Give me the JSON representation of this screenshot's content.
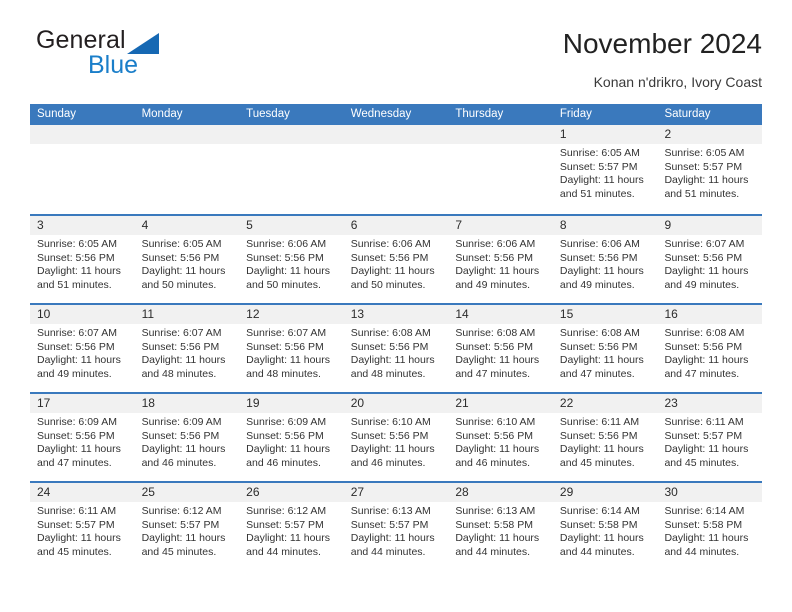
{
  "brand": {
    "word_one": "General",
    "word_two": "Blue",
    "triangle_color": "#1668b3",
    "blue_color": "#1a7ec9"
  },
  "header": {
    "title": "November 2024",
    "location": "Konan n'drikro, Ivory Coast"
  },
  "theme": {
    "header_blue": "#3a79bd",
    "daynum_band": "#f1f1f1"
  },
  "weekdays": [
    "Sunday",
    "Monday",
    "Tuesday",
    "Wednesday",
    "Thursday",
    "Friday",
    "Saturday"
  ],
  "weeks": [
    [
      {
        "day": "",
        "empty": true
      },
      {
        "day": "",
        "empty": true
      },
      {
        "day": "",
        "empty": true
      },
      {
        "day": "",
        "empty": true
      },
      {
        "day": "",
        "empty": true
      },
      {
        "day": "1",
        "sunrise": "Sunrise: 6:05 AM",
        "sunset": "Sunset: 5:57 PM",
        "daylight1": "Daylight: 11 hours",
        "daylight2": "and 51 minutes."
      },
      {
        "day": "2",
        "sunrise": "Sunrise: 6:05 AM",
        "sunset": "Sunset: 5:57 PM",
        "daylight1": "Daylight: 11 hours",
        "daylight2": "and 51 minutes."
      }
    ],
    [
      {
        "day": "3",
        "sunrise": "Sunrise: 6:05 AM",
        "sunset": "Sunset: 5:56 PM",
        "daylight1": "Daylight: 11 hours",
        "daylight2": "and 51 minutes."
      },
      {
        "day": "4",
        "sunrise": "Sunrise: 6:05 AM",
        "sunset": "Sunset: 5:56 PM",
        "daylight1": "Daylight: 11 hours",
        "daylight2": "and 50 minutes."
      },
      {
        "day": "5",
        "sunrise": "Sunrise: 6:06 AM",
        "sunset": "Sunset: 5:56 PM",
        "daylight1": "Daylight: 11 hours",
        "daylight2": "and 50 minutes."
      },
      {
        "day": "6",
        "sunrise": "Sunrise: 6:06 AM",
        "sunset": "Sunset: 5:56 PM",
        "daylight1": "Daylight: 11 hours",
        "daylight2": "and 50 minutes."
      },
      {
        "day": "7",
        "sunrise": "Sunrise: 6:06 AM",
        "sunset": "Sunset: 5:56 PM",
        "daylight1": "Daylight: 11 hours",
        "daylight2": "and 49 minutes."
      },
      {
        "day": "8",
        "sunrise": "Sunrise: 6:06 AM",
        "sunset": "Sunset: 5:56 PM",
        "daylight1": "Daylight: 11 hours",
        "daylight2": "and 49 minutes."
      },
      {
        "day": "9",
        "sunrise": "Sunrise: 6:07 AM",
        "sunset": "Sunset: 5:56 PM",
        "daylight1": "Daylight: 11 hours",
        "daylight2": "and 49 minutes."
      }
    ],
    [
      {
        "day": "10",
        "sunrise": "Sunrise: 6:07 AM",
        "sunset": "Sunset: 5:56 PM",
        "daylight1": "Daylight: 11 hours",
        "daylight2": "and 49 minutes."
      },
      {
        "day": "11",
        "sunrise": "Sunrise: 6:07 AM",
        "sunset": "Sunset: 5:56 PM",
        "daylight1": "Daylight: 11 hours",
        "daylight2": "and 48 minutes."
      },
      {
        "day": "12",
        "sunrise": "Sunrise: 6:07 AM",
        "sunset": "Sunset: 5:56 PM",
        "daylight1": "Daylight: 11 hours",
        "daylight2": "and 48 minutes."
      },
      {
        "day": "13",
        "sunrise": "Sunrise: 6:08 AM",
        "sunset": "Sunset: 5:56 PM",
        "daylight1": "Daylight: 11 hours",
        "daylight2": "and 48 minutes."
      },
      {
        "day": "14",
        "sunrise": "Sunrise: 6:08 AM",
        "sunset": "Sunset: 5:56 PM",
        "daylight1": "Daylight: 11 hours",
        "daylight2": "and 47 minutes."
      },
      {
        "day": "15",
        "sunrise": "Sunrise: 6:08 AM",
        "sunset": "Sunset: 5:56 PM",
        "daylight1": "Daylight: 11 hours",
        "daylight2": "and 47 minutes."
      },
      {
        "day": "16",
        "sunrise": "Sunrise: 6:08 AM",
        "sunset": "Sunset: 5:56 PM",
        "daylight1": "Daylight: 11 hours",
        "daylight2": "and 47 minutes."
      }
    ],
    [
      {
        "day": "17",
        "sunrise": "Sunrise: 6:09 AM",
        "sunset": "Sunset: 5:56 PM",
        "daylight1": "Daylight: 11 hours",
        "daylight2": "and 47 minutes."
      },
      {
        "day": "18",
        "sunrise": "Sunrise: 6:09 AM",
        "sunset": "Sunset: 5:56 PM",
        "daylight1": "Daylight: 11 hours",
        "daylight2": "and 46 minutes."
      },
      {
        "day": "19",
        "sunrise": "Sunrise: 6:09 AM",
        "sunset": "Sunset: 5:56 PM",
        "daylight1": "Daylight: 11 hours",
        "daylight2": "and 46 minutes."
      },
      {
        "day": "20",
        "sunrise": "Sunrise: 6:10 AM",
        "sunset": "Sunset: 5:56 PM",
        "daylight1": "Daylight: 11 hours",
        "daylight2": "and 46 minutes."
      },
      {
        "day": "21",
        "sunrise": "Sunrise: 6:10 AM",
        "sunset": "Sunset: 5:56 PM",
        "daylight1": "Daylight: 11 hours",
        "daylight2": "and 46 minutes."
      },
      {
        "day": "22",
        "sunrise": "Sunrise: 6:11 AM",
        "sunset": "Sunset: 5:56 PM",
        "daylight1": "Daylight: 11 hours",
        "daylight2": "and 45 minutes."
      },
      {
        "day": "23",
        "sunrise": "Sunrise: 6:11 AM",
        "sunset": "Sunset: 5:57 PM",
        "daylight1": "Daylight: 11 hours",
        "daylight2": "and 45 minutes."
      }
    ],
    [
      {
        "day": "24",
        "sunrise": "Sunrise: 6:11 AM",
        "sunset": "Sunset: 5:57 PM",
        "daylight1": "Daylight: 11 hours",
        "daylight2": "and 45 minutes."
      },
      {
        "day": "25",
        "sunrise": "Sunrise: 6:12 AM",
        "sunset": "Sunset: 5:57 PM",
        "daylight1": "Daylight: 11 hours",
        "daylight2": "and 45 minutes."
      },
      {
        "day": "26",
        "sunrise": "Sunrise: 6:12 AM",
        "sunset": "Sunset: 5:57 PM",
        "daylight1": "Daylight: 11 hours",
        "daylight2": "and 44 minutes."
      },
      {
        "day": "27",
        "sunrise": "Sunrise: 6:13 AM",
        "sunset": "Sunset: 5:57 PM",
        "daylight1": "Daylight: 11 hours",
        "daylight2": "and 44 minutes."
      },
      {
        "day": "28",
        "sunrise": "Sunrise: 6:13 AM",
        "sunset": "Sunset: 5:58 PM",
        "daylight1": "Daylight: 11 hours",
        "daylight2": "and 44 minutes."
      },
      {
        "day": "29",
        "sunrise": "Sunrise: 6:14 AM",
        "sunset": "Sunset: 5:58 PM",
        "daylight1": "Daylight: 11 hours",
        "daylight2": "and 44 minutes."
      },
      {
        "day": "30",
        "sunrise": "Sunrise: 6:14 AM",
        "sunset": "Sunset: 5:58 PM",
        "daylight1": "Daylight: 11 hours",
        "daylight2": "and 44 minutes."
      }
    ]
  ]
}
